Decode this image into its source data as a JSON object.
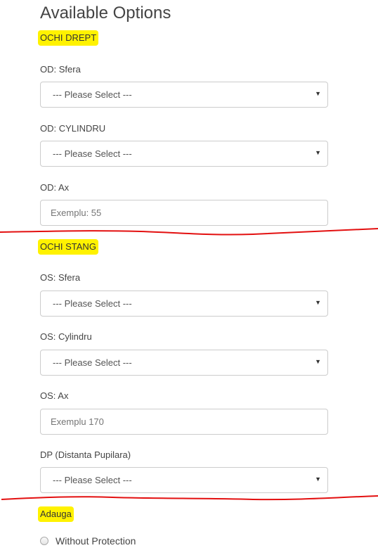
{
  "heading": "Available Options",
  "right_eye": {
    "section_label": "OCHI DREPT",
    "sphere": {
      "label": "OD: Sfera",
      "selected": "--- Please Select ---"
    },
    "cylinder": {
      "label": "OD: CYLINDRU",
      "selected": "--- Please Select ---"
    },
    "axis": {
      "label": "OD: Ax",
      "placeholder": "Exemplu: 55"
    }
  },
  "left_eye": {
    "section_label": "OCHI STANG",
    "sphere": {
      "label": "OS: Sfera",
      "selected": "--- Please Select ---"
    },
    "cylinder": {
      "label": "OS: Cylindru",
      "selected": "--- Please Select ---"
    },
    "axis": {
      "label": "OS: Ax",
      "placeholder": "Exemplu 170"
    }
  },
  "pupillary_distance": {
    "label": "DP (Distanta Pupilara)",
    "selected": "--- Please Select ---"
  },
  "addition": {
    "section_label": "Adauga",
    "options": [
      "Without Protection"
    ]
  },
  "colors": {
    "highlight": "#fff200",
    "annotation_line": "#e31010",
    "text": "#444444",
    "border": "#cccccc"
  },
  "icons": {
    "select_caret": "caret-down-icon"
  }
}
